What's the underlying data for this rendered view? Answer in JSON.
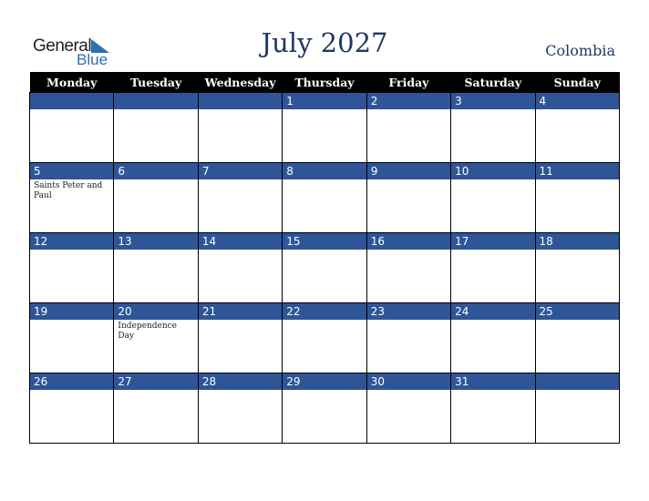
{
  "logo": {
    "line1": "General",
    "line2": "Blue"
  },
  "title": "July 2027",
  "country": "Colombia",
  "weekdays": [
    "Monday",
    "Tuesday",
    "Wednesday",
    "Thursday",
    "Friday",
    "Saturday",
    "Sunday"
  ],
  "weeks": [
    [
      {
        "day": "",
        "event": ""
      },
      {
        "day": "",
        "event": ""
      },
      {
        "day": "",
        "event": ""
      },
      {
        "day": "1",
        "event": ""
      },
      {
        "day": "2",
        "event": ""
      },
      {
        "day": "3",
        "event": ""
      },
      {
        "day": "4",
        "event": ""
      }
    ],
    [
      {
        "day": "5",
        "event": "Saints Peter and Paul"
      },
      {
        "day": "6",
        "event": ""
      },
      {
        "day": "7",
        "event": ""
      },
      {
        "day": "8",
        "event": ""
      },
      {
        "day": "9",
        "event": ""
      },
      {
        "day": "10",
        "event": ""
      },
      {
        "day": "11",
        "event": ""
      }
    ],
    [
      {
        "day": "12",
        "event": ""
      },
      {
        "day": "13",
        "event": ""
      },
      {
        "day": "14",
        "event": ""
      },
      {
        "day": "15",
        "event": ""
      },
      {
        "day": "16",
        "event": ""
      },
      {
        "day": "17",
        "event": ""
      },
      {
        "day": "18",
        "event": ""
      }
    ],
    [
      {
        "day": "19",
        "event": ""
      },
      {
        "day": "20",
        "event": "Independence Day"
      },
      {
        "day": "21",
        "event": ""
      },
      {
        "day": "22",
        "event": ""
      },
      {
        "day": "23",
        "event": ""
      },
      {
        "day": "24",
        "event": ""
      },
      {
        "day": "25",
        "event": ""
      }
    ],
    [
      {
        "day": "26",
        "event": ""
      },
      {
        "day": "27",
        "event": ""
      },
      {
        "day": "28",
        "event": ""
      },
      {
        "day": "29",
        "event": ""
      },
      {
        "day": "30",
        "event": ""
      },
      {
        "day": "31",
        "event": ""
      },
      {
        "day": "",
        "event": ""
      }
    ]
  ]
}
